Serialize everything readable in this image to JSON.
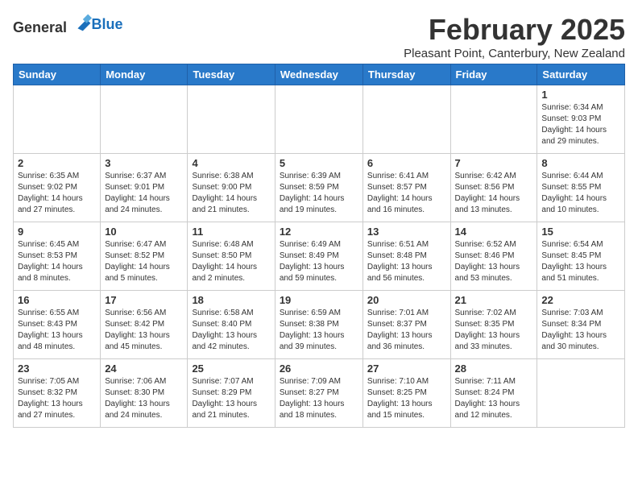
{
  "logo": {
    "general": "General",
    "blue": "Blue"
  },
  "header": {
    "month": "February 2025",
    "location": "Pleasant Point, Canterbury, New Zealand"
  },
  "weekdays": [
    "Sunday",
    "Monday",
    "Tuesday",
    "Wednesday",
    "Thursday",
    "Friday",
    "Saturday"
  ],
  "weeks": [
    [
      {
        "day": "",
        "info": ""
      },
      {
        "day": "",
        "info": ""
      },
      {
        "day": "",
        "info": ""
      },
      {
        "day": "",
        "info": ""
      },
      {
        "day": "",
        "info": ""
      },
      {
        "day": "",
        "info": ""
      },
      {
        "day": "1",
        "info": "Sunrise: 6:34 AM\nSunset: 9:03 PM\nDaylight: 14 hours and 29 minutes."
      }
    ],
    [
      {
        "day": "2",
        "info": "Sunrise: 6:35 AM\nSunset: 9:02 PM\nDaylight: 14 hours and 27 minutes."
      },
      {
        "day": "3",
        "info": "Sunrise: 6:37 AM\nSunset: 9:01 PM\nDaylight: 14 hours and 24 minutes."
      },
      {
        "day": "4",
        "info": "Sunrise: 6:38 AM\nSunset: 9:00 PM\nDaylight: 14 hours and 21 minutes."
      },
      {
        "day": "5",
        "info": "Sunrise: 6:39 AM\nSunset: 8:59 PM\nDaylight: 14 hours and 19 minutes."
      },
      {
        "day": "6",
        "info": "Sunrise: 6:41 AM\nSunset: 8:57 PM\nDaylight: 14 hours and 16 minutes."
      },
      {
        "day": "7",
        "info": "Sunrise: 6:42 AM\nSunset: 8:56 PM\nDaylight: 14 hours and 13 minutes."
      },
      {
        "day": "8",
        "info": "Sunrise: 6:44 AM\nSunset: 8:55 PM\nDaylight: 14 hours and 10 minutes."
      }
    ],
    [
      {
        "day": "9",
        "info": "Sunrise: 6:45 AM\nSunset: 8:53 PM\nDaylight: 14 hours and 8 minutes."
      },
      {
        "day": "10",
        "info": "Sunrise: 6:47 AM\nSunset: 8:52 PM\nDaylight: 14 hours and 5 minutes."
      },
      {
        "day": "11",
        "info": "Sunrise: 6:48 AM\nSunset: 8:50 PM\nDaylight: 14 hours and 2 minutes."
      },
      {
        "day": "12",
        "info": "Sunrise: 6:49 AM\nSunset: 8:49 PM\nDaylight: 13 hours and 59 minutes."
      },
      {
        "day": "13",
        "info": "Sunrise: 6:51 AM\nSunset: 8:48 PM\nDaylight: 13 hours and 56 minutes."
      },
      {
        "day": "14",
        "info": "Sunrise: 6:52 AM\nSunset: 8:46 PM\nDaylight: 13 hours and 53 minutes."
      },
      {
        "day": "15",
        "info": "Sunrise: 6:54 AM\nSunset: 8:45 PM\nDaylight: 13 hours and 51 minutes."
      }
    ],
    [
      {
        "day": "16",
        "info": "Sunrise: 6:55 AM\nSunset: 8:43 PM\nDaylight: 13 hours and 48 minutes."
      },
      {
        "day": "17",
        "info": "Sunrise: 6:56 AM\nSunset: 8:42 PM\nDaylight: 13 hours and 45 minutes."
      },
      {
        "day": "18",
        "info": "Sunrise: 6:58 AM\nSunset: 8:40 PM\nDaylight: 13 hours and 42 minutes."
      },
      {
        "day": "19",
        "info": "Sunrise: 6:59 AM\nSunset: 8:38 PM\nDaylight: 13 hours and 39 minutes."
      },
      {
        "day": "20",
        "info": "Sunrise: 7:01 AM\nSunset: 8:37 PM\nDaylight: 13 hours and 36 minutes."
      },
      {
        "day": "21",
        "info": "Sunrise: 7:02 AM\nSunset: 8:35 PM\nDaylight: 13 hours and 33 minutes."
      },
      {
        "day": "22",
        "info": "Sunrise: 7:03 AM\nSunset: 8:34 PM\nDaylight: 13 hours and 30 minutes."
      }
    ],
    [
      {
        "day": "23",
        "info": "Sunrise: 7:05 AM\nSunset: 8:32 PM\nDaylight: 13 hours and 27 minutes."
      },
      {
        "day": "24",
        "info": "Sunrise: 7:06 AM\nSunset: 8:30 PM\nDaylight: 13 hours and 24 minutes."
      },
      {
        "day": "25",
        "info": "Sunrise: 7:07 AM\nSunset: 8:29 PM\nDaylight: 13 hours and 21 minutes."
      },
      {
        "day": "26",
        "info": "Sunrise: 7:09 AM\nSunset: 8:27 PM\nDaylight: 13 hours and 18 minutes."
      },
      {
        "day": "27",
        "info": "Sunrise: 7:10 AM\nSunset: 8:25 PM\nDaylight: 13 hours and 15 minutes."
      },
      {
        "day": "28",
        "info": "Sunrise: 7:11 AM\nSunset: 8:24 PM\nDaylight: 13 hours and 12 minutes."
      },
      {
        "day": "",
        "info": ""
      }
    ]
  ]
}
